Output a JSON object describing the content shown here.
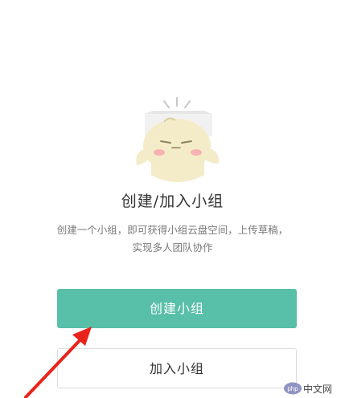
{
  "empty_state": {
    "title": "创建/加入小组",
    "description_line1": "创建一个小组，即可获得小组云盘空间，上传草稿，",
    "description_line2": "实现多人团队协作"
  },
  "actions": {
    "create_label": "创建小组",
    "join_label": "加入小组"
  },
  "watermark": {
    "text": "php中文网"
  },
  "colors": {
    "primary": "#58bfa9",
    "arrow": "#e8231b"
  }
}
